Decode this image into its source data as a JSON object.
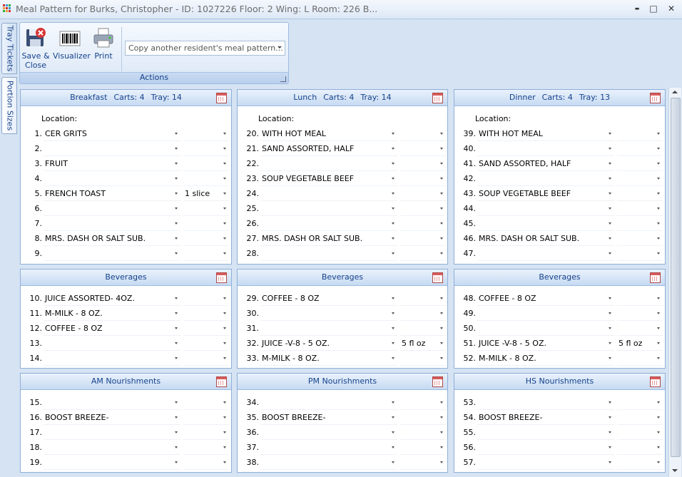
{
  "window": {
    "title": "Meal Pattern for Burks, Christopher - ID: 1027226 Floor: 2 Wing: L Room: 226 B...",
    "minimize": "▬",
    "maximize": "□",
    "close": "✕"
  },
  "side_tabs": [
    {
      "label": "Tray Tickets"
    },
    {
      "label": "Portion Sizes"
    }
  ],
  "ribbon": {
    "group_label": "Actions",
    "save_close_label": "Save &\nClose",
    "visualizer_label": "Visualizer",
    "print_label": "Print",
    "copy_placeholder": "Copy another resident's meal pattern...",
    "icons": [
      "save-icon",
      "barcode-icon",
      "printer-icon"
    ]
  },
  "panels": {
    "breakfast": {
      "title": "Breakfast",
      "carts": "Carts: 4",
      "tray": "Tray: 14",
      "location_label": "Location:",
      "location_value": "",
      "rows": [
        {
          "n": "1.",
          "food": "CER GRITS",
          "portion": ""
        },
        {
          "n": "2.",
          "food": "",
          "portion": ""
        },
        {
          "n": "3.",
          "food": "FRUIT",
          "portion": ""
        },
        {
          "n": "4.",
          "food": "",
          "portion": ""
        },
        {
          "n": "5.",
          "food": "FRENCH TOAST",
          "portion": "1 slice"
        },
        {
          "n": "6.",
          "food": "",
          "portion": ""
        },
        {
          "n": "7.",
          "food": "",
          "portion": ""
        },
        {
          "n": "8.",
          "food": "MRS. DASH OR SALT SUB.",
          "portion": ""
        },
        {
          "n": "9.",
          "food": "",
          "portion": ""
        }
      ]
    },
    "lunch": {
      "title": "Lunch",
      "carts": "Carts: 4",
      "tray": "Tray: 14",
      "location_label": "Location:",
      "location_value": "",
      "rows": [
        {
          "n": "20.",
          "food": "WITH HOT MEAL",
          "portion": ""
        },
        {
          "n": "21.",
          "food": "SAND ASSORTED, HALF",
          "portion": ""
        },
        {
          "n": "22.",
          "food": "",
          "portion": ""
        },
        {
          "n": "23.",
          "food": "SOUP VEGETABLE BEEF",
          "portion": ""
        },
        {
          "n": "24.",
          "food": "",
          "portion": ""
        },
        {
          "n": "25.",
          "food": "",
          "portion": ""
        },
        {
          "n": "26.",
          "food": "",
          "portion": ""
        },
        {
          "n": "27.",
          "food": "MRS. DASH OR SALT SUB.",
          "portion": ""
        },
        {
          "n": "28.",
          "food": "",
          "portion": ""
        }
      ]
    },
    "dinner": {
      "title": "Dinner",
      "carts": "Carts: 4",
      "tray": "Tray: 13",
      "location_label": "Location:",
      "location_value": "",
      "rows": [
        {
          "n": "39.",
          "food": "WITH HOT MEAL",
          "portion": ""
        },
        {
          "n": "40.",
          "food": "",
          "portion": ""
        },
        {
          "n": "41.",
          "food": "SAND ASSORTED, HALF",
          "portion": ""
        },
        {
          "n": "42.",
          "food": "",
          "portion": ""
        },
        {
          "n": "43.",
          "food": "SOUP VEGETABLE BEEF",
          "portion": ""
        },
        {
          "n": "44.",
          "food": "",
          "portion": ""
        },
        {
          "n": "45.",
          "food": "",
          "portion": ""
        },
        {
          "n": "46.",
          "food": "MRS. DASH OR SALT SUB.",
          "portion": ""
        },
        {
          "n": "47.",
          "food": "",
          "portion": ""
        }
      ]
    },
    "bev_breakfast": {
      "title": "Beverages",
      "rows": [
        {
          "n": "10.",
          "food": "JUICE  ASSORTED- 4OZ.",
          "portion": ""
        },
        {
          "n": "11.",
          "food": "M-MILK - 8 OZ.",
          "portion": ""
        },
        {
          "n": "12.",
          "food": "COFFEE - 8 OZ",
          "portion": ""
        },
        {
          "n": "13.",
          "food": "",
          "portion": ""
        },
        {
          "n": "14.",
          "food": "",
          "portion": ""
        }
      ]
    },
    "bev_lunch": {
      "title": "Beverages",
      "rows": [
        {
          "n": "29.",
          "food": "COFFEE - 8 OZ",
          "portion": ""
        },
        {
          "n": "30.",
          "food": "",
          "portion": ""
        },
        {
          "n": "31.",
          "food": "",
          "portion": ""
        },
        {
          "n": "32.",
          "food": " JUICE -V-8 - 5 OZ.",
          "portion": "5 fl oz"
        },
        {
          "n": "33.",
          "food": "M-MILK - 8 OZ.",
          "portion": ""
        }
      ]
    },
    "bev_dinner": {
      "title": "Beverages",
      "rows": [
        {
          "n": "48.",
          "food": "COFFEE - 8 OZ",
          "portion": ""
        },
        {
          "n": "49.",
          "food": "",
          "portion": ""
        },
        {
          "n": "50.",
          "food": "",
          "portion": ""
        },
        {
          "n": "51.",
          "food": " JUICE -V-8 - 5 OZ.",
          "portion": "5 fl oz"
        },
        {
          "n": "52.",
          "food": "M-MILK - 8 OZ.",
          "portion": ""
        }
      ]
    },
    "am_nour": {
      "title": "AM Nourishments",
      "rows": [
        {
          "n": "15.",
          "food": "",
          "portion": ""
        },
        {
          "n": "16.",
          "food": "BOOST BREEZE-",
          "portion": ""
        },
        {
          "n": "17.",
          "food": "",
          "portion": ""
        },
        {
          "n": "18.",
          "food": "",
          "portion": ""
        },
        {
          "n": "19.",
          "food": "",
          "portion": ""
        }
      ]
    },
    "pm_nour": {
      "title": "PM Nourishments",
      "rows": [
        {
          "n": "34.",
          "food": "",
          "portion": ""
        },
        {
          "n": "35.",
          "food": "BOOST BREEZE-",
          "portion": ""
        },
        {
          "n": "36.",
          "food": "",
          "portion": ""
        },
        {
          "n": "37.",
          "food": "",
          "portion": ""
        },
        {
          "n": "38.",
          "food": "",
          "portion": ""
        }
      ]
    },
    "hs_nour": {
      "title": "HS Nourishments",
      "rows": [
        {
          "n": "53.",
          "food": "",
          "portion": ""
        },
        {
          "n": "54.",
          "food": "BOOST BREEZE-",
          "portion": ""
        },
        {
          "n": "55.",
          "food": "",
          "portion": ""
        },
        {
          "n": "56.",
          "food": "",
          "portion": ""
        },
        {
          "n": "57.",
          "food": "",
          "portion": ""
        }
      ]
    }
  },
  "colors": {
    "accent_text": "#15428b",
    "background": "#d5e3f3",
    "panel_border": "#8fafd7"
  }
}
